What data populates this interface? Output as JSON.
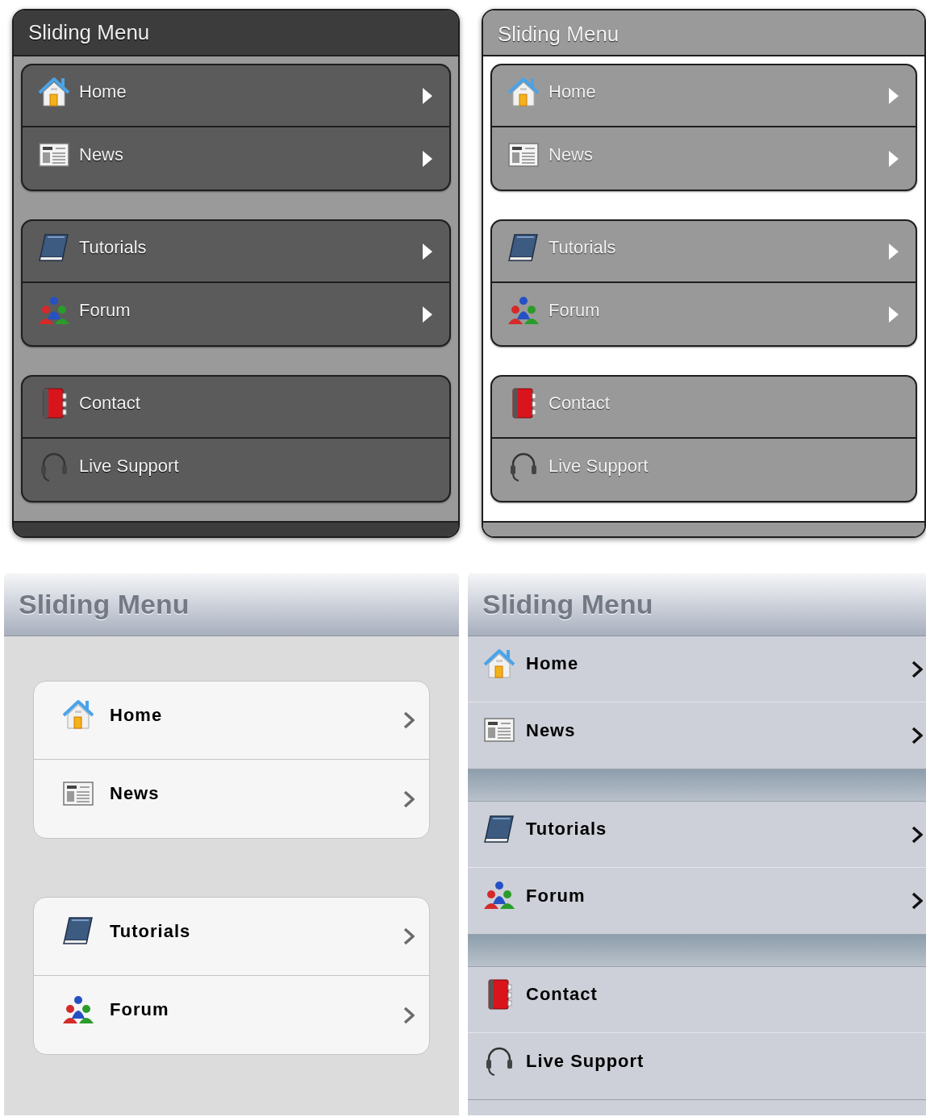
{
  "panels": [
    {
      "kind": "dark",
      "title": "Sliding Menu",
      "groups": [
        {
          "items": [
            {
              "label": "Home",
              "kind": "house",
              "arrow": true
            },
            {
              "label": "News",
              "kind": "newspaper",
              "arrow": true
            }
          ]
        },
        {
          "items": [
            {
              "label": "Tutorials",
              "kind": "book",
              "arrow": true
            },
            {
              "label": "Forum",
              "kind": "people",
              "arrow": true
            }
          ]
        },
        {
          "items": [
            {
              "label": "Contact",
              "kind": "addressbook",
              "arrow": false
            },
            {
              "label": "Live Support",
              "kind": "headset",
              "arrow": false
            }
          ]
        }
      ]
    },
    {
      "kind": "gray",
      "title": "Sliding Menu",
      "groups": [
        {
          "items": [
            {
              "label": "Home",
              "kind": "house",
              "arrow": true
            },
            {
              "label": "News",
              "kind": "newspaper",
              "arrow": true
            }
          ]
        },
        {
          "items": [
            {
              "label": "Tutorials",
              "kind": "book",
              "arrow": true
            },
            {
              "label": "Forum",
              "kind": "people",
              "arrow": true
            }
          ]
        },
        {
          "items": [
            {
              "label": "Contact",
              "kind": "addressbook",
              "arrow": false
            },
            {
              "label": "Live Support",
              "kind": "headset",
              "arrow": false
            }
          ]
        }
      ]
    },
    {
      "kind": "inset",
      "title": "Sliding Menu",
      "groups": [
        {
          "items": [
            {
              "label": "Home",
              "kind": "house",
              "arrow": true
            },
            {
              "label": "News",
              "kind": "newspaper",
              "arrow": true
            }
          ]
        },
        {
          "items": [
            {
              "label": "Tutorials",
              "kind": "book",
              "arrow": true
            },
            {
              "label": "Forum",
              "kind": "people",
              "arrow": true
            }
          ]
        }
      ]
    },
    {
      "kind": "flat",
      "title": "Sliding Menu",
      "groups": [
        {
          "items": [
            {
              "label": "Home",
              "kind": "house",
              "arrow": true
            },
            {
              "label": "News",
              "kind": "newspaper",
              "arrow": true
            }
          ]
        },
        {
          "items": [
            {
              "label": "Tutorials",
              "kind": "book",
              "arrow": true
            },
            {
              "label": "Forum",
              "kind": "people",
              "arrow": true
            }
          ]
        },
        {
          "items": [
            {
              "label": "Contact",
              "kind": "addressbook",
              "arrow": false
            },
            {
              "label": "Live Support",
              "kind": "headset",
              "arrow": false
            }
          ]
        }
      ]
    }
  ]
}
